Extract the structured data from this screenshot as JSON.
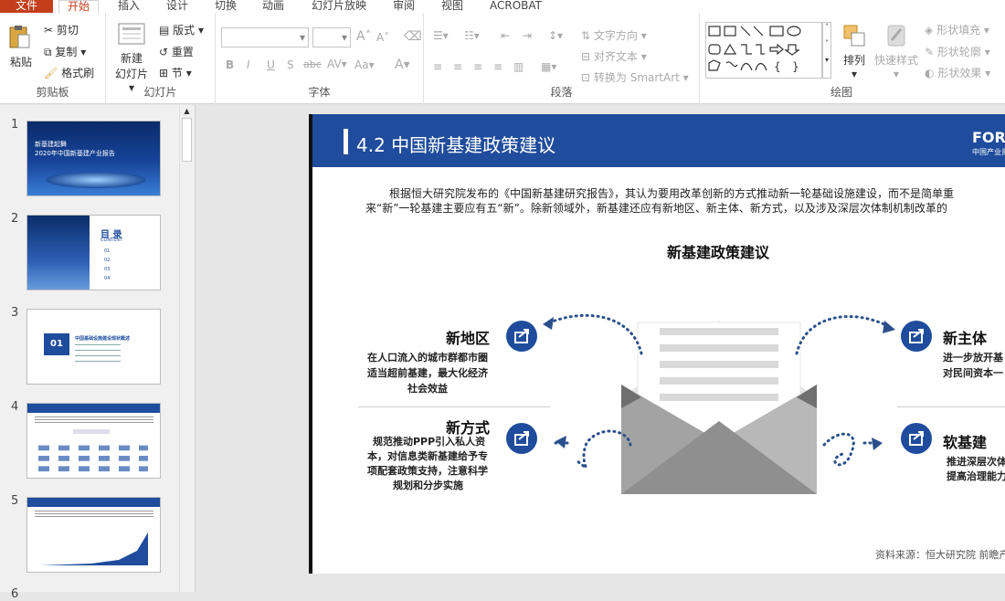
{
  "tabs": {
    "file": "文件",
    "home": "开始",
    "insert": "插入",
    "design": "设计",
    "transitions": "切换",
    "animations": "动画",
    "slideshow": "幻灯片放映",
    "review": "审阅",
    "view": "视图",
    "acrobat": "ACROBAT"
  },
  "ribbon": {
    "clipboard": {
      "paste": "粘贴",
      "cut": "剪切",
      "copy": "复制",
      "format_painter": "格式刷",
      "label": "剪贴板"
    },
    "slides": {
      "new_slide": "新建",
      "new_slide2": "幻灯片",
      "layout": "版式",
      "reset": "重置",
      "section": "节",
      "label": "幻灯片"
    },
    "font": {
      "label": "字体",
      "bold": "B",
      "italic": "I",
      "underline": "U",
      "shadow": "S",
      "strike": "abc",
      "spacing": "AV",
      "case": "Aa",
      "color": "A",
      "grow": "A",
      "shrink": "A"
    },
    "paragraph": {
      "text_direction": "文字方向",
      "align_text": "对齐文本",
      "smartart": "转换为 SmartArt",
      "label": "段落"
    },
    "drawing": {
      "arrange": "排列",
      "quick_styles": "快速样式",
      "fill": "形状填充",
      "outline": "形状轮廓",
      "effects": "形状效果",
      "label": "绘图"
    }
  },
  "slides": [
    {
      "num": "1",
      "title": "新基建起舞",
      "subtitle": "2020年中国新基建产业报告"
    },
    {
      "num": "2",
      "title": "目 录",
      "sub": "CONTENT",
      "items": [
        "01",
        "02",
        "03",
        "04"
      ]
    },
    {
      "num": "3",
      "chapter": "01",
      "title": "中国基础设施建设现状概述"
    },
    {
      "num": "4"
    },
    {
      "num": "5"
    }
  ],
  "slide": {
    "section_title": "4.2  中国新基建政策建议",
    "logo": "FOR",
    "logo_sub": "中国产业资",
    "intro_line1": "根据恒大研究院发布的《中国新基建研究报告》，其认为要用改革创新的方式推动新一轮基础设施建设，而不是简单重",
    "intro_line2": "来“新”一轮基建主要应有五“新”。除新领域外，新基建还应有新地区、新主体、新方式，以及涉及深层次体制机制改革的",
    "diagram_title": "新基建政策建议",
    "points": [
      {
        "name": "新地区",
        "desc1": "在人口流入的城市群都市圈",
        "desc2": "适当超前基建，最大化经济",
        "desc3": "社会效益"
      },
      {
        "name": "新方式",
        "desc1": "规范推动PPP引入私人资",
        "desc2": "本，对信息类新基建给予专",
        "desc3": "项配套政策支持，注意科学",
        "desc4": "规划和分步实施"
      },
      {
        "name": "新主体",
        "desc1": "进一步放开基",
        "desc2": "对民间资本一"
      },
      {
        "name": "软基建",
        "desc1": "推进深层次体",
        "desc2": "提高治理能力"
      }
    ],
    "source": "资料来源：恒大研究院  前瞻产"
  },
  "colors": {
    "accent": "#c43e1c",
    "slide_blue": "#1f4c9c"
  }
}
